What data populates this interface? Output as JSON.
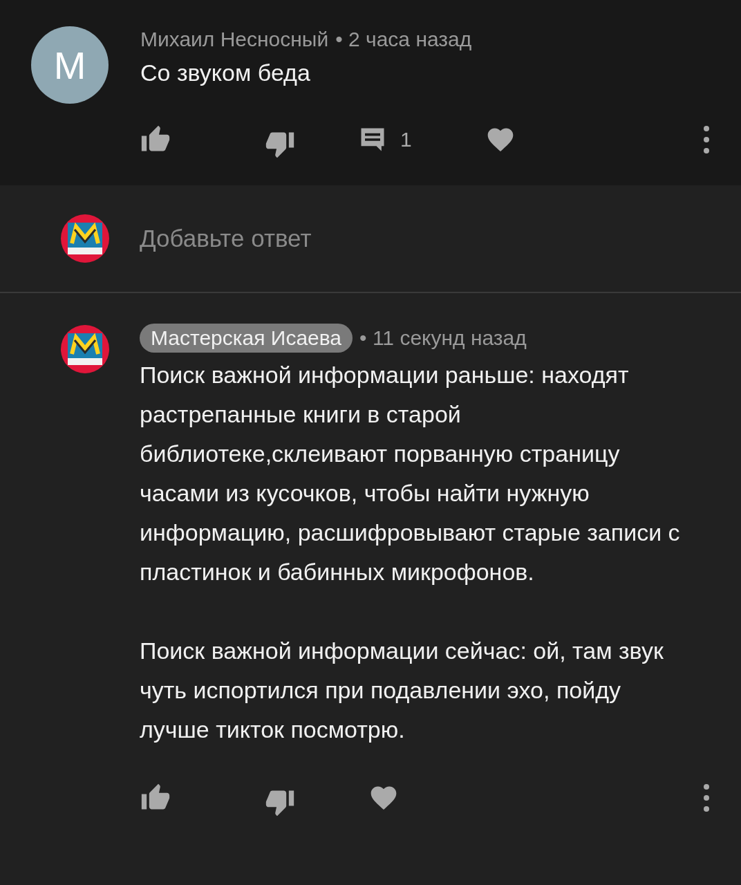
{
  "comment": {
    "avatar_letter": "М",
    "author": "Михаил Несносный",
    "time": "• 2 часа назад",
    "text": "Со звуком беда",
    "reply_count": "1"
  },
  "reply_box": {
    "placeholder": "Добавьте ответ"
  },
  "reply": {
    "author": "Мастерская Исаева",
    "time": "• 11 секунд назад",
    "paragraphs": [
      "Поиск важной информации раньше: находят растрепанные книги в старой библиотеке,склеивают порванную страницу часами из кусочков, чтобы найти нужную информацию, расшифровывают старые записи с пластинок и бабинных микрофонов.",
      "Поиск важной информации сейчас: ой, там звук чуть испортился при подавлении эхо, пойду лучше тикток посмотрю."
    ]
  }
}
